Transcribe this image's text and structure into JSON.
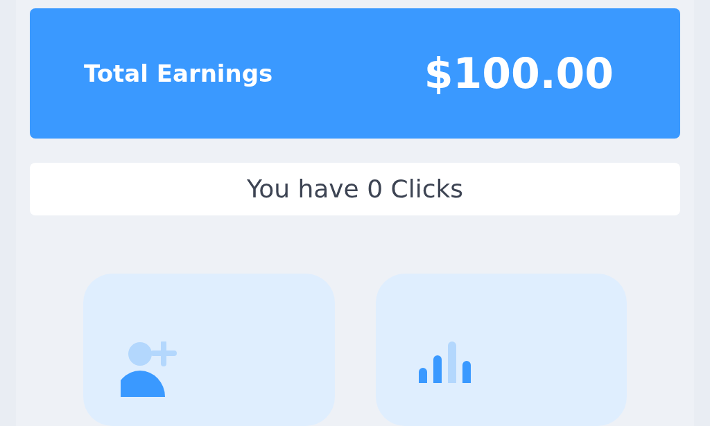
{
  "earnings": {
    "label": "Total Earnings",
    "amount": "$100.00"
  },
  "clicks": {
    "text": "You have 0 Clicks"
  },
  "tiles": [
    {
      "kind": "add-user"
    },
    {
      "kind": "chart"
    }
  ]
}
